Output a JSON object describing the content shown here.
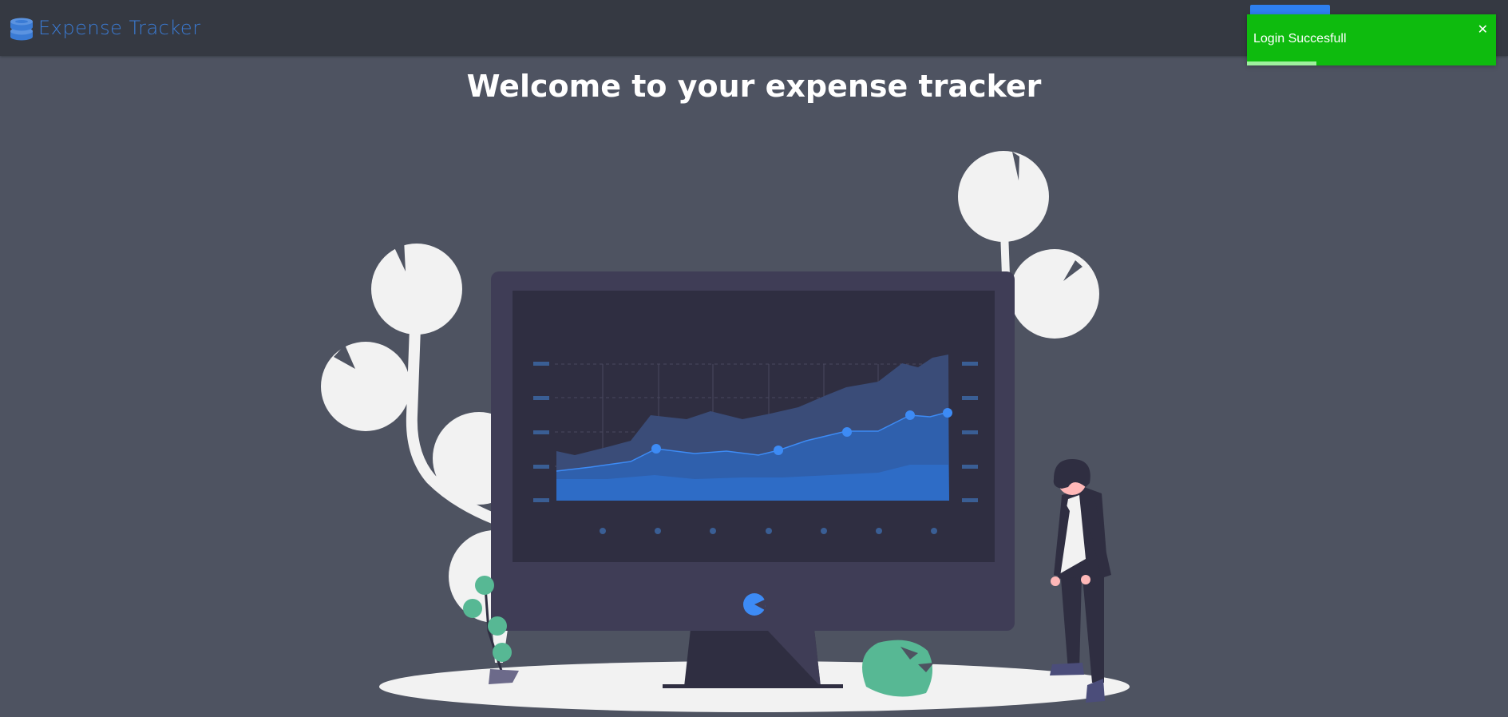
{
  "navbar": {
    "brand_name": "Expense Tracker",
    "brand_icon": "coins-stack-icon",
    "accent_color": "#3a7bd5"
  },
  "main": {
    "heading": "Welcome to your expense tracker",
    "illustration": "monitor-with-area-chart-person-plants-illustration"
  },
  "toast": {
    "message": "Login Succesfull",
    "close_icon": "close-icon",
    "color": "#0ebb0e",
    "progress_fraction": 0.28
  }
}
